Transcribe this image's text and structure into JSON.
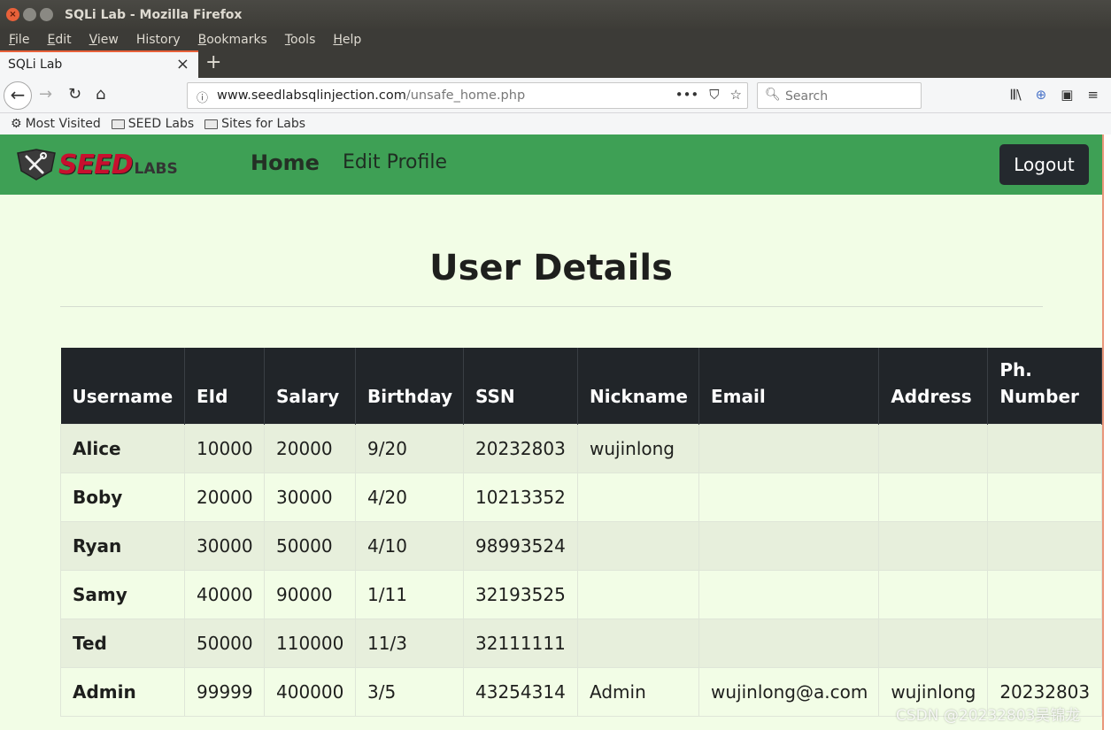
{
  "window": {
    "title": "SQLi Lab - Mozilla Firefox"
  },
  "menubar": {
    "items": [
      {
        "label": "File",
        "accel": "F",
        "rest": "ile"
      },
      {
        "label": "Edit",
        "accel": "E",
        "rest": "dit"
      },
      {
        "label": "View",
        "accel": "V",
        "rest": "iew"
      },
      {
        "label": "History",
        "accel": "",
        "rest": "History"
      },
      {
        "label": "Bookmarks",
        "accel": "B",
        "rest": "ookmarks"
      },
      {
        "label": "Tools",
        "accel": "T",
        "rest": "ools"
      },
      {
        "label": "Help",
        "accel": "H",
        "rest": "elp"
      }
    ]
  },
  "tab": {
    "label": "SQLi Lab"
  },
  "urlbar": {
    "domain": "www.seedlabsqlinjection.com",
    "path": "/unsafe_home.php"
  },
  "searchbar": {
    "placeholder": "Search"
  },
  "bookmarks": {
    "most_visited": "Most Visited",
    "seed_labs": "SEED Labs",
    "sites_for_labs": "Sites for Labs"
  },
  "site": {
    "logo_seed": "SEED",
    "logo_labs": "LABS",
    "nav_home": "Home",
    "nav_edit": "Edit Profile",
    "logout": "Logout"
  },
  "heading": "User Details",
  "table": {
    "headers": [
      "Username",
      "EId",
      "Salary",
      "Birthday",
      "SSN",
      "Nickname",
      "Email",
      "Address",
      "Ph. Number"
    ],
    "rows": [
      [
        "Alice",
        "10000",
        "20000",
        "9/20",
        "20232803",
        "wujinlong",
        "",
        "",
        ""
      ],
      [
        "Boby",
        "20000",
        "30000",
        "4/20",
        "10213352",
        "",
        "",
        "",
        ""
      ],
      [
        "Ryan",
        "30000",
        "50000",
        "4/10",
        "98993524",
        "",
        "",
        "",
        ""
      ],
      [
        "Samy",
        "40000",
        "90000",
        "1/11",
        "32193525",
        "",
        "",
        "",
        ""
      ],
      [
        "Ted",
        "50000",
        "110000",
        "11/3",
        "32111111",
        "",
        "",
        "",
        ""
      ],
      [
        "Admin",
        "99999",
        "400000",
        "3/5",
        "43254314",
        "Admin",
        "wujinlong@a.com",
        "wujinlong",
        "20232803"
      ]
    ]
  },
  "watermark": "CSDN @20232803吴锦龙"
}
